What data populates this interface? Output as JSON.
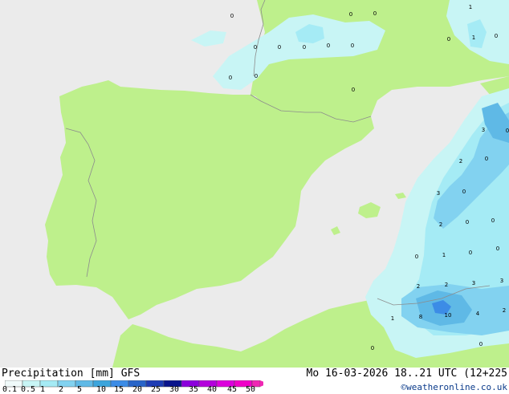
{
  "map": {
    "colors": {
      "sea": "#ebebeb",
      "land_outside_model": "#bef08c",
      "precip_0_1": "#c8f5f5",
      "precip_0_5": "#a5ebf5",
      "precip_1": "#82d2f0",
      "precip_2": "#5fb9e6",
      "precip_5": "#3c8ce6",
      "border": "#8c8c8c",
      "coast": "#8c8c8c"
    },
    "value_labels": [
      "0",
      "0",
      "0",
      "0",
      "0",
      "0",
      "0",
      "0",
      "0",
      "0",
      "0",
      "0",
      "1",
      "1",
      "0",
      "3",
      "2",
      "0",
      "0",
      "3",
      "0",
      "2",
      "0",
      "0",
      "1",
      "0",
      "0",
      "0",
      "2",
      "2",
      "3",
      "3",
      "1",
      "8",
      "10",
      "4",
      "2",
      "0",
      "0"
    ]
  },
  "footer": {
    "legend_title": "Precipitation [mm] GFS",
    "run_info": "Mo 16-03-2026 18..21 UTC (12+225",
    "credit": "©weatheronline.co.uk",
    "scale_colors": [
      "#f0fafa",
      "#c8f5f5",
      "#a5ebf5",
      "#82d2f0",
      "#5fb9e6",
      "#3ca5dc",
      "#3c8ce6",
      "#2864c8",
      "#1e3cb4",
      "#0a148c",
      "#8c00dc",
      "#b400dc",
      "#dc00dc",
      "#f000c8",
      "#f028b4"
    ],
    "scale_ticks": [
      "0.1",
      "0.5",
      "1",
      "2",
      "5",
      "10",
      "15",
      "20",
      "25",
      "30",
      "35",
      "40",
      "45",
      "50"
    ]
  }
}
